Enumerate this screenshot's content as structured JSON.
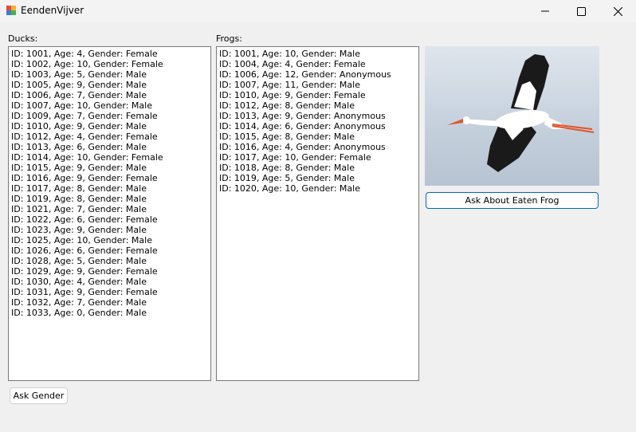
{
  "window": {
    "title": "EendenVijver"
  },
  "labels": {
    "ducks": "Ducks:",
    "frogs": "Frogs:"
  },
  "ducks": [
    "ID: 1001, Age: 4, Gender: Female",
    "ID: 1002, Age: 10, Gender: Female",
    "ID: 1003, Age: 5, Gender: Male",
    "ID: 1005, Age: 9, Gender: Male",
    "ID: 1006, Age: 7, Gender: Male",
    "ID: 1007, Age: 10, Gender: Male",
    "ID: 1009, Age: 7, Gender: Female",
    "ID: 1010, Age: 9, Gender: Male",
    "ID: 1012, Age: 4, Gender: Female",
    "ID: 1013, Age: 6, Gender: Male",
    "ID: 1014, Age: 10, Gender: Female",
    "ID: 1015, Age: 9, Gender: Male",
    "ID: 1016, Age: 9, Gender: Female",
    "ID: 1017, Age: 8, Gender: Male",
    "ID: 1019, Age: 8, Gender: Male",
    "ID: 1021, Age: 7, Gender: Male",
    "ID: 1022, Age: 6, Gender: Female",
    "ID: 1023, Age: 9, Gender: Male",
    "ID: 1025, Age: 10, Gender: Male",
    "ID: 1026, Age: 6, Gender: Female",
    "ID: 1028, Age: 5, Gender: Male",
    "ID: 1029, Age: 9, Gender: Female",
    "ID: 1030, Age: 4, Gender: Male",
    "ID: 1031, Age: 9, Gender: Female",
    "ID: 1032, Age: 7, Gender: Male",
    "ID: 1033, Age: 0, Gender: Male"
  ],
  "frogs": [
    "ID: 1001, Age: 10, Gender: Male",
    "ID: 1004, Age: 4, Gender: Female",
    "ID: 1006, Age: 12, Gender: Anonymous",
    "ID: 1007, Age: 11, Gender: Male",
    "ID: 1010, Age: 9, Gender: Female",
    "ID: 1012, Age: 8, Gender: Male",
    "ID: 1013, Age: 9, Gender: Anonymous",
    "ID: 1014, Age: 6, Gender: Anonymous",
    "ID: 1015, Age: 8, Gender: Male",
    "ID: 1016, Age: 4, Gender: Anonymous",
    "ID: 1017, Age: 10, Gender: Female",
    "ID: 1018, Age: 8, Gender: Male",
    "ID: 1019, Age: 5, Gender: Male",
    "ID: 1020, Age: 10, Gender: Male"
  ],
  "buttons": {
    "ask_eaten_frog": "Ask About Eaten Frog",
    "ask_gender": "Ask Gender"
  },
  "image": {
    "subject": "stork-photo"
  },
  "colors": {
    "accent": "#0067c0",
    "sky": "#c9d6e6"
  }
}
